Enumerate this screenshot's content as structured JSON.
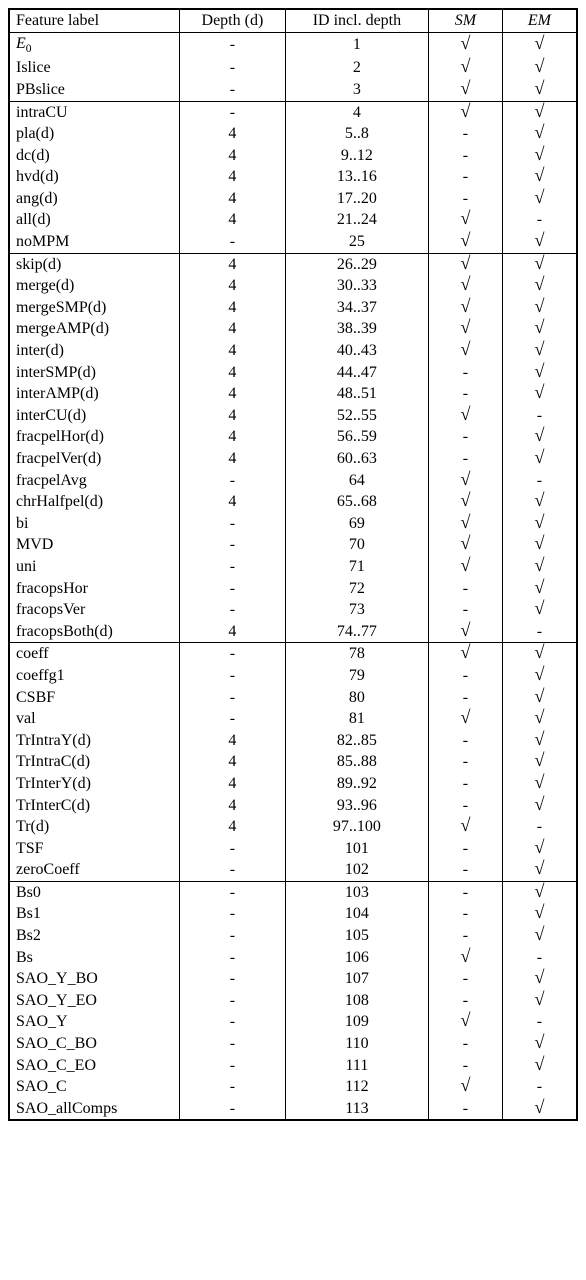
{
  "headers": {
    "feature": "Feature label",
    "depth": "Depth (d)",
    "id": "ID incl. depth",
    "sm": "SM",
    "em": "EM"
  },
  "check_glyph": "√",
  "groups": [
    {
      "rows": [
        {
          "label_html": "<i>E</i><span class=\"sub\">0</span>",
          "depth": "-",
          "id": "1",
          "sm": true,
          "em": true
        },
        {
          "label": "Islice",
          "depth": "-",
          "id": "2",
          "sm": true,
          "em": true
        },
        {
          "label": "PBslice",
          "depth": "-",
          "id": "3",
          "sm": true,
          "em": true
        }
      ]
    },
    {
      "rows": [
        {
          "label": "intraCU",
          "depth": "-",
          "id": "4",
          "sm": true,
          "em": true
        },
        {
          "label": "pla(d)",
          "depth": "4",
          "id": "5..8",
          "sm": false,
          "em": true
        },
        {
          "label": "dc(d)",
          "depth": "4",
          "id": "9..12",
          "sm": false,
          "em": true
        },
        {
          "label": "hvd(d)",
          "depth": "4",
          "id": "13..16",
          "sm": false,
          "em": true
        },
        {
          "label": "ang(d)",
          "depth": "4",
          "id": "17..20",
          "sm": false,
          "em": true
        },
        {
          "label": "all(d)",
          "depth": "4",
          "id": "21..24",
          "sm": true,
          "em": false
        },
        {
          "label": "noMPM",
          "depth": "-",
          "id": "25",
          "sm": true,
          "em": true
        }
      ]
    },
    {
      "rows": [
        {
          "label": "skip(d)",
          "depth": "4",
          "id": "26..29",
          "sm": true,
          "em": true
        },
        {
          "label": "merge(d)",
          "depth": "4",
          "id": "30..33",
          "sm": true,
          "em": true
        },
        {
          "label": "mergeSMP(d)",
          "depth": "4",
          "id": "34..37",
          "sm": true,
          "em": true
        },
        {
          "label": "mergeAMP(d)",
          "depth": "4",
          "id": "38..39",
          "sm": true,
          "em": true
        },
        {
          "label": "inter(d)",
          "depth": "4",
          "id": "40..43",
          "sm": true,
          "em": true
        },
        {
          "label": "interSMP(d)",
          "depth": "4",
          "id": "44..47",
          "sm": false,
          "em": true
        },
        {
          "label": "interAMP(d)",
          "depth": "4",
          "id": "48..51",
          "sm": false,
          "em": true
        },
        {
          "label": "interCU(d)",
          "depth": "4",
          "id": "52..55",
          "sm": true,
          "em": false
        },
        {
          "label": "fracpelHor(d)",
          "depth": "4",
          "id": "56..59",
          "sm": false,
          "em": true
        },
        {
          "label": "fracpelVer(d)",
          "depth": "4",
          "id": "60..63",
          "sm": false,
          "em": true
        },
        {
          "label": "fracpelAvg",
          "depth": "-",
          "id": "64",
          "sm": true,
          "em": false
        },
        {
          "label": "chrHalfpel(d)",
          "depth": "4",
          "id": "65..68",
          "sm": true,
          "em": true
        },
        {
          "label": "bi",
          "depth": "-",
          "id": "69",
          "sm": true,
          "em": true
        },
        {
          "label": "MVD",
          "depth": "-",
          "id": "70",
          "sm": true,
          "em": true
        },
        {
          "label": "uni",
          "depth": "-",
          "id": "71",
          "sm": true,
          "em": true
        },
        {
          "label": "fracopsHor",
          "depth": "-",
          "id": "72",
          "sm": false,
          "em": true
        },
        {
          "label": "fracopsVer",
          "depth": "-",
          "id": "73",
          "sm": false,
          "em": true
        },
        {
          "label": "fracopsBoth(d)",
          "depth": "4",
          "id": "74..77",
          "sm": true,
          "em": false
        }
      ]
    },
    {
      "rows": [
        {
          "label": "coeff",
          "depth": "-",
          "id": "78",
          "sm": true,
          "em": true
        },
        {
          "label": "coeffg1",
          "depth": "-",
          "id": "79",
          "sm": false,
          "em": true
        },
        {
          "label": "CSBF",
          "depth": "-",
          "id": "80",
          "sm": false,
          "em": true
        },
        {
          "label": "val",
          "depth": "-",
          "id": "81",
          "sm": true,
          "em": true
        },
        {
          "label": "TrIntraY(d)",
          "depth": "4",
          "id": "82..85",
          "sm": false,
          "em": true
        },
        {
          "label": "TrIntraC(d)",
          "depth": "4",
          "id": "85..88",
          "sm": false,
          "em": true
        },
        {
          "label": "TrInterY(d)",
          "depth": "4",
          "id": "89..92",
          "sm": false,
          "em": true
        },
        {
          "label": "TrInterC(d)",
          "depth": "4",
          "id": "93..96",
          "sm": false,
          "em": true
        },
        {
          "label": "Tr(d)",
          "depth": "4",
          "id": "97..100",
          "sm": true,
          "em": false
        },
        {
          "label": "TSF",
          "depth": "-",
          "id": "101",
          "sm": false,
          "em": true
        },
        {
          "label": "zeroCoeff",
          "depth": "-",
          "id": "102",
          "sm": false,
          "em": true
        }
      ]
    },
    {
      "rows": [
        {
          "label": "Bs0",
          "depth": "-",
          "id": "103",
          "sm": false,
          "em": true
        },
        {
          "label": "Bs1",
          "depth": "-",
          "id": "104",
          "sm": false,
          "em": true
        },
        {
          "label": "Bs2",
          "depth": "-",
          "id": "105",
          "sm": false,
          "em": true
        },
        {
          "label": "Bs",
          "depth": "-",
          "id": "106",
          "sm": true,
          "em": false
        },
        {
          "label": "SAO_Y_BO",
          "depth": "-",
          "id": "107",
          "sm": false,
          "em": true
        },
        {
          "label": "SAO_Y_EO",
          "depth": "-",
          "id": "108",
          "sm": false,
          "em": true
        },
        {
          "label": "SAO_Y",
          "depth": "-",
          "id": "109",
          "sm": true,
          "em": false
        },
        {
          "label": "SAO_C_BO",
          "depth": "-",
          "id": "110",
          "sm": false,
          "em": true
        },
        {
          "label": "SAO_C_EO",
          "depth": "-",
          "id": "111",
          "sm": false,
          "em": true
        },
        {
          "label": "SAO_C",
          "depth": "-",
          "id": "112",
          "sm": true,
          "em": false
        },
        {
          "label": "SAO_allComps",
          "depth": "-",
          "id": "113",
          "sm": false,
          "em": true
        }
      ]
    }
  ]
}
